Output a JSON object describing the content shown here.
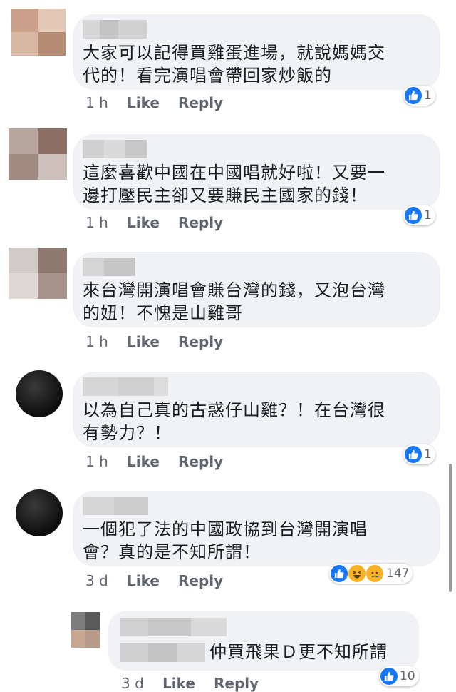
{
  "comments": [
    {
      "text_line1": "大家可以記得買雞蛋進場，就說媽媽交",
      "text_line2": "代的！看完演唱會帶回家炒飯的",
      "time": "1 h",
      "like": "Like",
      "reply": "Reply",
      "reactions": "1"
    },
    {
      "text_line1": "這麼喜歡中國在中國唱就好啦！又要一",
      "text_line2": "邊打壓民主卻又要賺民主國家的錢！",
      "time": "1 h",
      "like": "Like",
      "reply": "Reply",
      "reactions": "1"
    },
    {
      "text_line1": "來台灣開演唱會賺台灣的錢，又泡台灣",
      "text_line2": "的妞！不愧是山雞哥",
      "time": "1 h",
      "like": "Like",
      "reply": "Reply",
      "reactions": ""
    },
    {
      "text_line1": "以為自己真的古惑仔山雞？！在台灣很",
      "text_line2": "有勢力？！",
      "time": "1 h",
      "like": "Like",
      "reply": "Reply",
      "reactions": "1"
    },
    {
      "text_line1": "一個犯了法的中國政協到台灣開演唱",
      "text_line2": "會？真的是不知所謂！",
      "time": "3 d",
      "like": "Like",
      "reply": "Reply",
      "reactions": "147"
    }
  ],
  "reply_comment": {
    "text": "仲買飛果Ｄ更不知所謂",
    "time": "3 d",
    "like": "Like",
    "reply": "Reply",
    "reactions": "10"
  },
  "icons": {
    "like": "thumbs-up-icon",
    "haha": "laughing-emoji-icon",
    "sad": "sad-emoji-icon"
  },
  "colors": {
    "bubble": "#f0f2f5",
    "like_blue": "#1877f2",
    "meta": "#606770"
  }
}
